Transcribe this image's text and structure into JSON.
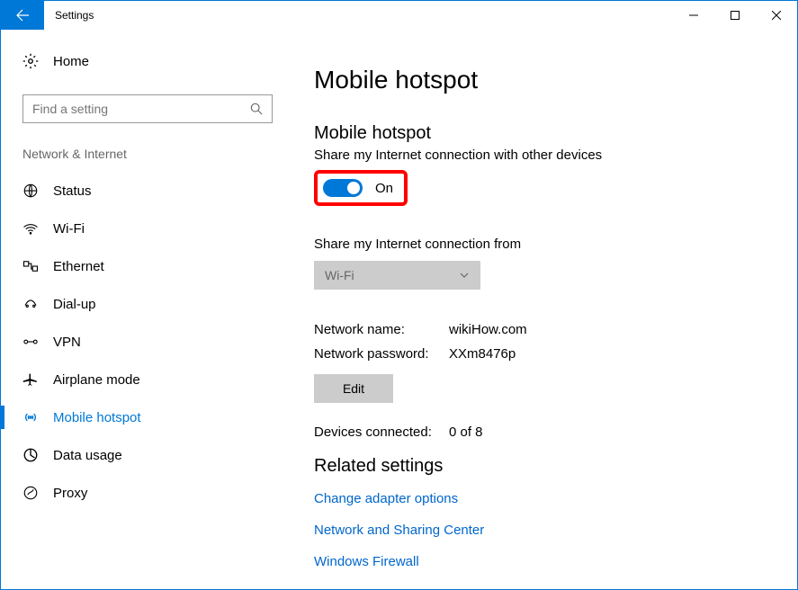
{
  "titlebar": {
    "title": "Settings"
  },
  "sidebar": {
    "home_label": "Home",
    "search_placeholder": "Find a setting",
    "category": "Network & Internet",
    "items": [
      {
        "label": "Status"
      },
      {
        "label": "Wi-Fi"
      },
      {
        "label": "Ethernet"
      },
      {
        "label": "Dial-up"
      },
      {
        "label": "VPN"
      },
      {
        "label": "Airplane mode"
      },
      {
        "label": "Mobile hotspot"
      },
      {
        "label": "Data usage"
      },
      {
        "label": "Proxy"
      }
    ]
  },
  "content": {
    "page_title": "Mobile hotspot",
    "section_title": "Mobile hotspot",
    "section_sub": "Share my Internet connection with other devices",
    "toggle_state": "On",
    "share_from_label": "Share my Internet connection from",
    "share_from_value": "Wi-Fi",
    "network_name_label": "Network name:",
    "network_name_value": "wikiHow.com",
    "network_password_label": "Network password:",
    "network_password_value": "XXm8476p",
    "edit_label": "Edit",
    "devices_label": "Devices connected:",
    "devices_value": "0 of 8",
    "related_title": "Related settings",
    "links": [
      "Change adapter options",
      "Network and Sharing Center",
      "Windows Firewall"
    ]
  }
}
